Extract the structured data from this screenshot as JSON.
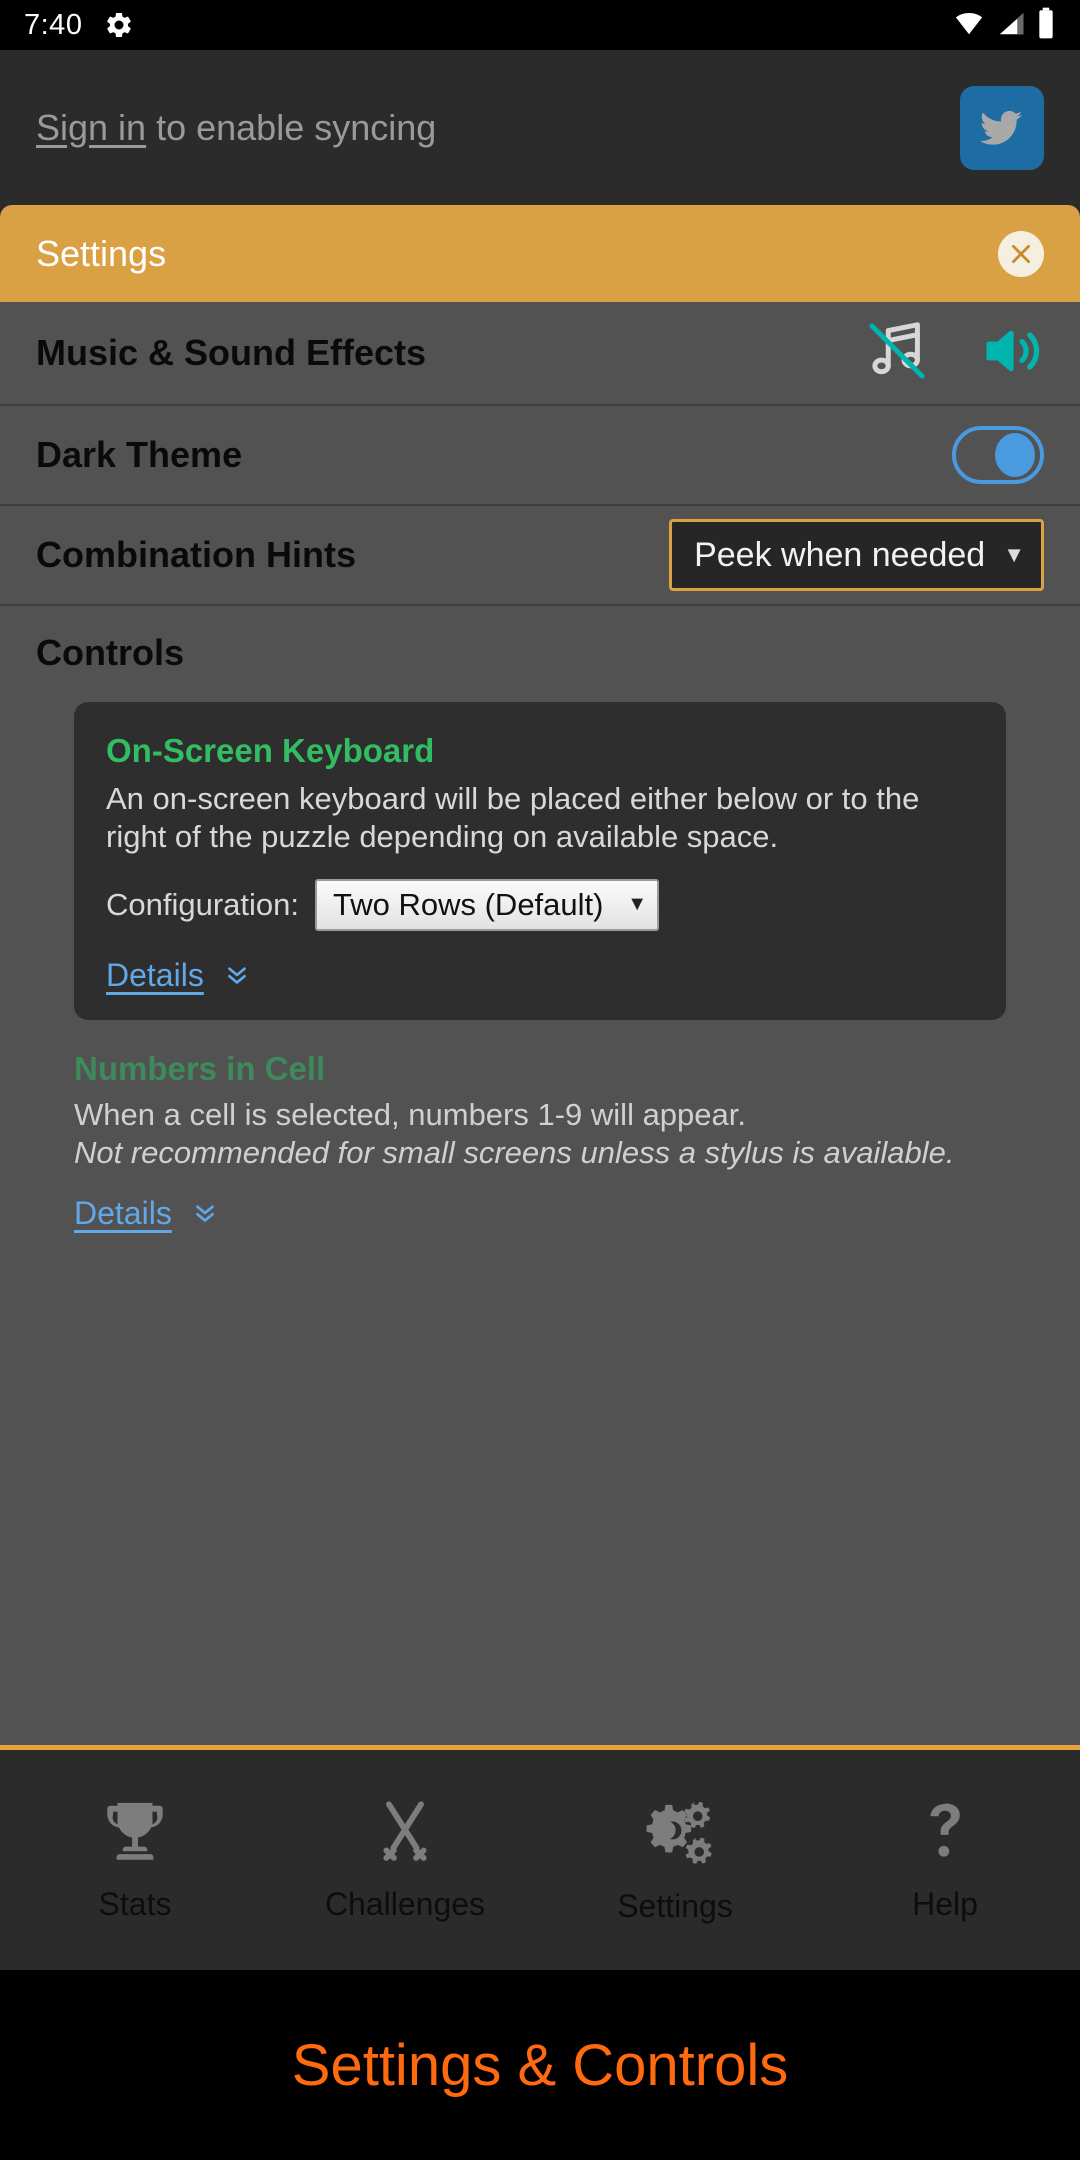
{
  "status_bar": {
    "time": "7:40",
    "gear_icon": "gear-icon",
    "wifi_icon": "wifi-icon",
    "signal_icon": "cell-signal-icon",
    "battery_icon": "battery-icon"
  },
  "signin": {
    "link_label": "Sign in",
    "rest_label": " to enable syncing",
    "badge_icon": "twitter-icon"
  },
  "panel": {
    "title": "Settings",
    "close_label": "✕",
    "rows": {
      "music": {
        "label": "Music & Sound Effects",
        "music_muted_icon": "music-note-muted-icon",
        "sound_on_icon": "speaker-on-icon"
      },
      "theme": {
        "label": "Dark Theme",
        "toggle_state": "on"
      },
      "hints": {
        "label": "Combination Hints",
        "value": "Peek when needed",
        "arrow": "▼"
      }
    },
    "controls": {
      "heading": "Controls",
      "keyboard_card": {
        "title": "On-Screen Keyboard",
        "description": "An on-screen keyboard will be placed either below or to the right of the puzzle depending on available space.",
        "config_label": "Configuration:",
        "config_value": "Two Rows (Default)",
        "config_arrow": "▼",
        "details_label": "Details",
        "details_chevron": "chevron-double-down-icon"
      },
      "numbers_card": {
        "title": "Numbers in Cell",
        "description": "When a cell is selected, numbers 1-9 will appear.",
        "description_italic": "Not recommended for small screens unless a stylus is available.",
        "details_label": "Details",
        "details_chevron": "chevron-double-down-icon"
      }
    }
  },
  "bottom_nav": {
    "items": [
      {
        "label": "Stats",
        "icon": "trophy-icon"
      },
      {
        "label": "Challenges",
        "icon": "crossed-swords-icon"
      },
      {
        "label": "Settings",
        "icon": "gears-icon"
      },
      {
        "label": "Help",
        "icon": "question-mark-icon"
      }
    ]
  },
  "caption": {
    "text": "Settings & Controls"
  },
  "colors": {
    "accent_orange": "#daa044",
    "caption_orange": "#ff6a10",
    "toggle_blue": "#4a9ae0",
    "link_blue": "#62a7e8",
    "title_green": "#33bd62",
    "muted_green": "#3f8a5b",
    "teal": "#00b5ad",
    "panel_bg": "#525252",
    "card_bg": "#2e2e2e",
    "screen_bg": "#2b2b2b"
  }
}
